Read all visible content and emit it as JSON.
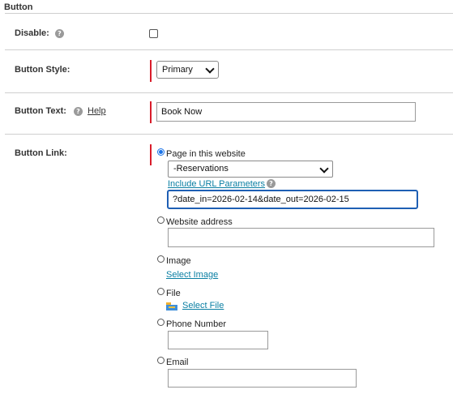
{
  "section": {
    "title": "Button"
  },
  "disable": {
    "label": "Disable:",
    "help": "?"
  },
  "style": {
    "label": "Button Style:",
    "selected": "Primary"
  },
  "text": {
    "label": "Button Text:",
    "help": "?",
    "help_link": "Help",
    "value": "Book Now"
  },
  "link": {
    "label": "Button Link:",
    "options": {
      "page": "Page in this website",
      "website": "Website address",
      "image": "Image",
      "file": "File",
      "phone": "Phone Number",
      "email": "Email"
    },
    "page_select": "-Reservations",
    "include_params": "Include URL Parameters",
    "params_help": "?",
    "params_value": "?date_in=2026-02-14&date_out=2026-02-15",
    "select_image": "Select Image",
    "select_file": "Select File",
    "website_value": "",
    "phone_value": "",
    "email_value": ""
  },
  "colors": {
    "accent": "#0a7fa3",
    "required_bar": "#d91c2a",
    "focus": "#1e5fb4"
  }
}
